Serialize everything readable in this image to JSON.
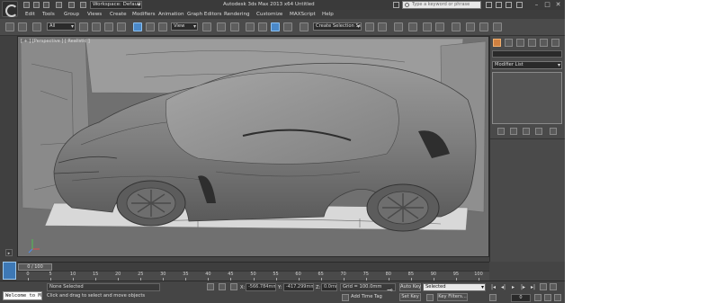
{
  "titlebar": {
    "workspace": "Workspace: Default",
    "title": "Autodesk 3ds Max 2013 x64     Untitled",
    "help_search_placeholder": "Type a keyword or phrase"
  },
  "menubar": {
    "items": [
      "Edit",
      "Tools",
      "Group",
      "Views",
      "Create",
      "Modifiers",
      "Animation",
      "Graph Editors",
      "Rendering",
      "Customize",
      "MAXScript",
      "Help"
    ]
  },
  "toolbar": {
    "filter_selection": "All",
    "reference_coord": "View",
    "named_selection_set": "Create Selection Se"
  },
  "viewport": {
    "label": "[ + ] [Perspective ] [ Realistic ]"
  },
  "command_panel": {
    "modifier_list": "Modifier List"
  },
  "time": {
    "slider_text": "0 / 100",
    "ticks": [
      "0",
      "5",
      "10",
      "15",
      "20",
      "25",
      "30",
      "35",
      "40",
      "45",
      "50",
      "55",
      "60",
      "65",
      "70",
      "75",
      "80",
      "85",
      "90",
      "95",
      "100"
    ]
  },
  "status": {
    "maxscript_listener": "Welcome to M",
    "selection": "None Selected",
    "prompt": "Click and drag to select and move objects",
    "x_label": "X:",
    "x_value": "-566.784mm",
    "y_label": "Y:",
    "y_value": "-417.299mm",
    "z_label": "Z:",
    "z_value": "0.0mm",
    "grid": "Grid = 100.0mm",
    "add_time_tag": "Add Time Tag",
    "auto_key": "Auto Key",
    "set_key": "Set Key",
    "key_mode": "Selected",
    "key_filters": "Key Filters...",
    "current_frame": "0"
  },
  "colors": {
    "ui_background": "#444444",
    "viewport_background": "#707070",
    "active_tool_blue": "#4a88c8"
  }
}
